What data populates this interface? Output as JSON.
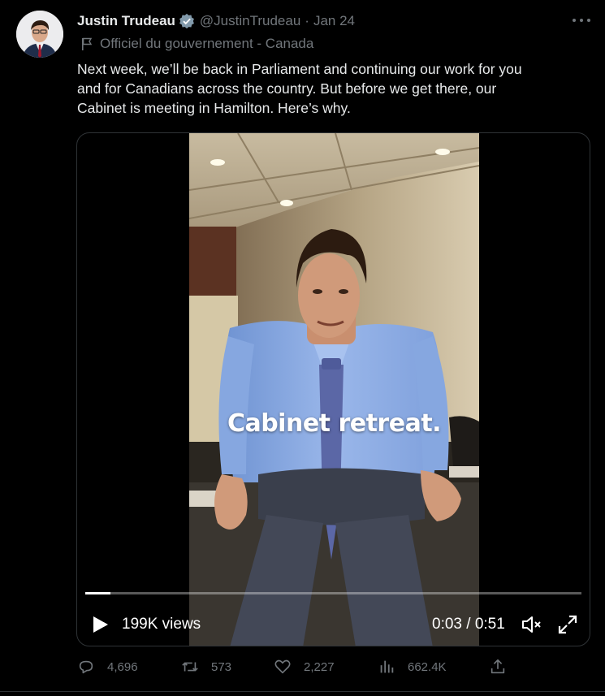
{
  "tweet": {
    "author_name": "Justin Trudeau",
    "handle": "@JustinTrudeau",
    "separator": "·",
    "date": "Jan 24",
    "label": "Officiel du gouvernement - Canada",
    "text_lines": [
      "Next week, we’ll be back in Parliament and continuing our work for you",
      "and for Canadians across the country. But before we get there, our",
      "Cabinet is meeting in Hamilton. Here’s why."
    ]
  },
  "video": {
    "caption": "Cabinet retreat.",
    "views": "199K views",
    "time": "0:03 / 0:51",
    "progress": 0.05
  },
  "actions": {
    "replies": "4,696",
    "retweets": "573",
    "likes": "2,227",
    "views": "662.4K"
  },
  "icons": {
    "verified": "verified-badge-icon",
    "more": "more-icon",
    "flag": "flag-icon",
    "play": "play-icon",
    "mute": "mute-icon",
    "fullscreen": "fullscreen-icon",
    "reply": "reply-icon",
    "retweet": "retweet-icon",
    "like": "heart-icon",
    "analytics": "analytics-icon",
    "share": "share-icon"
  },
  "colors": {
    "background": "#000000",
    "text": "#e7e9ea",
    "muted": "#71767b",
    "verified": "#829aab",
    "border": "#2f3336"
  }
}
